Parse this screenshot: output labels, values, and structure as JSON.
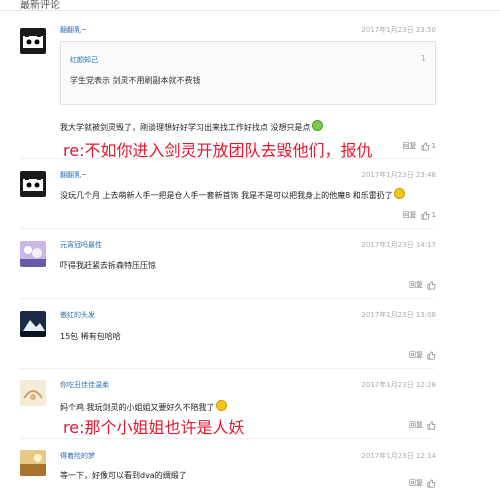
{
  "section_title": "最新评论",
  "comments": [
    {
      "name": "翻翻乳~",
      "time": "2017年1月23日 23:50",
      "quote": {
        "name": "红颜知己",
        "floor": "1",
        "text": "学生党表示 剑灵不用刷副本就不费钱"
      },
      "body": "我大学就被剑灵毁了，刚谈理想好好学习出来找工作好找点 没想只是点",
      "reply": "re:不如你进入剑灵开放团队去毁他们，报仇",
      "reply_label": "回复",
      "likes": "1"
    },
    {
      "name": "翻翻乳~",
      "time": "2017年1月23日 23:48",
      "body": "没玩几个月 上去萌新人手一把是仓人手一套新首饰 我是不是可以把我身上的他魔8 和乐雷扔了",
      "reply_label": "回复",
      "likes": "1"
    },
    {
      "name": "元宵冠吗最性",
      "time": "2017年1月23日 14:17",
      "body": "吓得我赶紧去拆森特压压惊",
      "reply_label": "回复",
      "likes": ""
    },
    {
      "name": "傲红的头发",
      "time": "2017年1月23日 13:08",
      "body": "15包 稀有包哈哈",
      "reply_label": "回复",
      "likes": ""
    },
    {
      "name": "你吃丑佳佳温柔",
      "time": "2017年1月23日 12:28",
      "body": "妈个鸡 我玩剑灵的小姐姐又要好久不陪我了",
      "reply": "re:那个小姐姐也许是人妖",
      "reply_label": "回复",
      "likes": ""
    },
    {
      "name": "得着险的梦",
      "time": "2017年1月23日 12:14",
      "body": "等一下，好像可以看到dva的绸缎了",
      "reply_label": "回复",
      "likes": ""
    }
  ],
  "colors": {
    "link": "#2a6fb0",
    "reply": "#e6162d"
  }
}
